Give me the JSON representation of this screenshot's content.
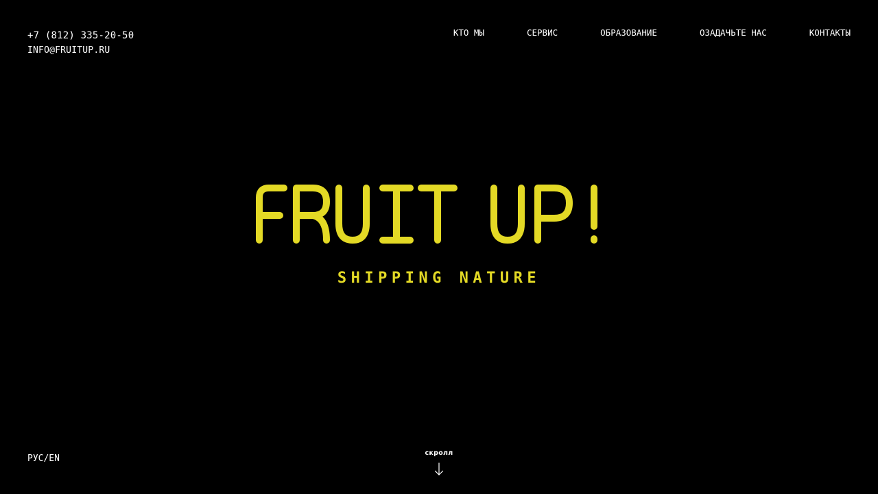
{
  "contact": {
    "phone": "+7 (812) 335-20-50",
    "email": "INFO@FRUITUP.RU"
  },
  "nav": {
    "items": [
      {
        "label": "КТО МЫ"
      },
      {
        "label": "СЕРВИС"
      },
      {
        "label": "ОБРАЗОВАНИЕ"
      },
      {
        "label": "ОЗАДАЧЬТЕ НАС"
      },
      {
        "label": "КОНТАКТЫ"
      }
    ]
  },
  "hero": {
    "logo_text": "FRUIT UP!",
    "tagline": "SHIPPING NATURE"
  },
  "footer": {
    "language": "РУС/EN",
    "scroll_label": "скролл",
    "scroll_icon": "arrow-down-icon"
  },
  "colors": {
    "background": "#000000",
    "accent": "#e3d925",
    "text": "#ffffff"
  }
}
